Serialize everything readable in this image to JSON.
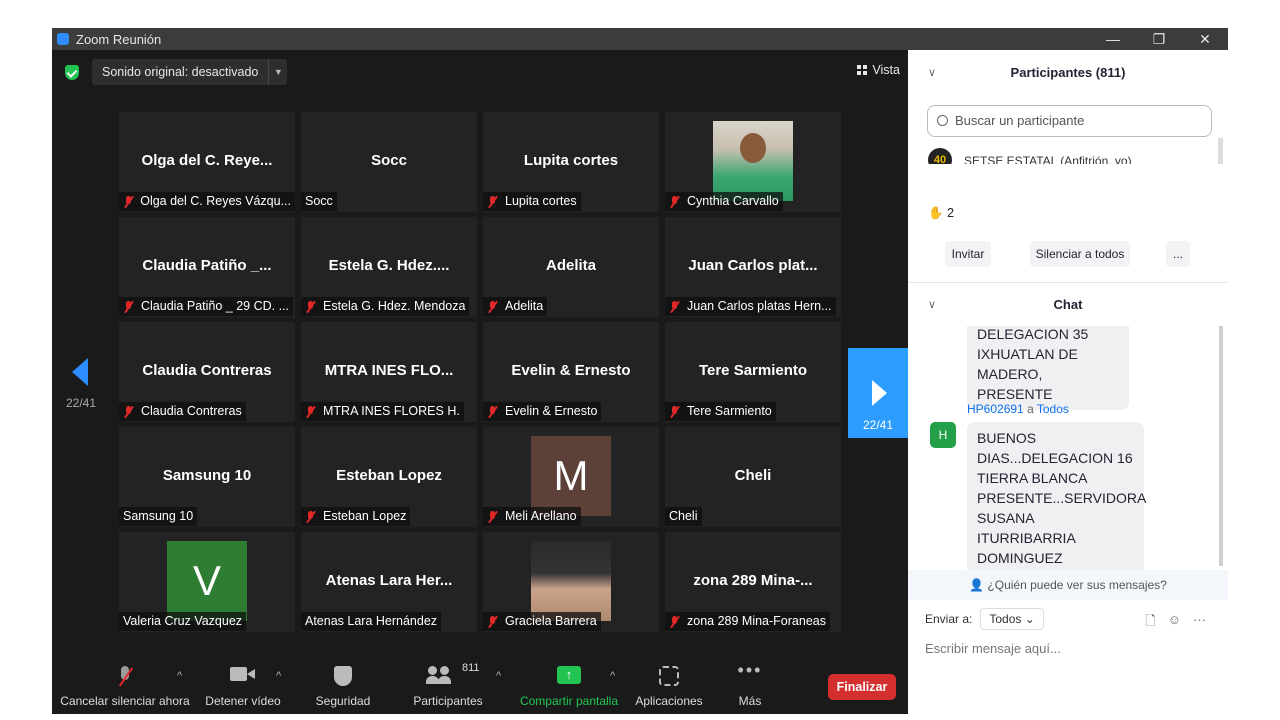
{
  "window": {
    "title": "Zoom Reunión",
    "controls": [
      "—",
      "❐",
      "✕"
    ]
  },
  "topbar": {
    "sound_label": "Sonido original: desactivado",
    "view_label": "Vista"
  },
  "gallery": {
    "page_left": "22/41",
    "page_right": "22/41",
    "tiles": [
      {
        "big": "Olga del C. Reye...",
        "name": "Olga del C. Reyes Vázqu...",
        "muted": true
      },
      {
        "big": "Socc",
        "name": "Socc",
        "muted": false
      },
      {
        "big": "Lupita cortes",
        "name": "Lupita cortes",
        "muted": true
      },
      {
        "big": "",
        "name": "Cynthia Carvallo",
        "muted": true,
        "avatar": "photo-person"
      },
      {
        "big": "Claudia Patiño _...",
        "name": "Claudia Patiño _ 29 CD. ...",
        "muted": true
      },
      {
        "big": "Estela G. Hdez....",
        "name": "Estela G. Hdez. Mendoza",
        "muted": true
      },
      {
        "big": "Adelita",
        "name": "Adelita",
        "muted": true
      },
      {
        "big": "Juan Carlos plat...",
        "name": "Juan Carlos platas Hern...",
        "muted": true
      },
      {
        "big": "Claudia Contreras",
        "name": "Claudia Contreras",
        "muted": true
      },
      {
        "big": "MTRA INES FLO...",
        "name": "MTRA INES FLORES H.",
        "muted": true
      },
      {
        "big": "Evelin & Ernesto",
        "name": "Evelin & Ernesto",
        "muted": true
      },
      {
        "big": "Tere Sarmiento",
        "name": "Tere Sarmiento",
        "muted": true
      },
      {
        "big": "Samsung 10",
        "name": "Samsung 10",
        "muted": false
      },
      {
        "big": "Esteban Lopez",
        "name": "Esteban Lopez",
        "muted": true
      },
      {
        "big": "",
        "name": "Meli Arellano",
        "muted": true,
        "avatar": "letter",
        "letter": "M",
        "color": "#5d4037"
      },
      {
        "big": "Cheli",
        "name": "Cheli",
        "muted": false
      },
      {
        "big": "",
        "name": "Valeria Cruz Vazquez",
        "muted": false,
        "avatar": "letter",
        "letter": "V",
        "color": "#2e7d32"
      },
      {
        "big": "Atenas Lara Her...",
        "name": "Atenas Lara Hernández",
        "muted": false
      },
      {
        "big": "",
        "name": "Graciela Barrera",
        "muted": true,
        "avatar": "photo-hand"
      },
      {
        "big": "zona 289 Mina-...",
        "name": "zona 289 Mina-Foraneas",
        "muted": true
      }
    ]
  },
  "toolbar": {
    "mute_label": "Cancelar silenciar ahora",
    "video_label": "Detener vídeo",
    "security_label": "Seguridad",
    "participants_label": "Participantes",
    "participants_count": "811",
    "share_label": "Compartir pantalla",
    "apps_label": "Aplicaciones",
    "more_label": "Más",
    "end_label": "Finalizar"
  },
  "participants_panel": {
    "title": "Participantes (811)",
    "search_placeholder": "Buscar un participante",
    "host_row": "SETSE ESTATAL (Anfitrión, yo)",
    "raised_hands": "2",
    "invite_label": "Invitar",
    "mute_all_label": "Silenciar a todos",
    "more_label": "..."
  },
  "chat": {
    "title": "Chat",
    "prev_message": "DELEGACION 35\nIXHUATLAN DE\nMADERO, PRESENTE",
    "sender": "HP602691",
    "to_word": "a",
    "recipient": "Todos",
    "avatar_letter": "H",
    "message": "BUENOS\nDIAS...DELEGACION 16\nTIERRA BLANCA\nPRESENTE...SERVIDORA\nSUSANA ITURRIBARRIA\nDOMINGUEZ",
    "who_can_see": "¿Quién puede ver sus mensajes?",
    "send_to_label": "Enviar a:",
    "send_to_value": "Todos",
    "input_placeholder": "Escribir mensaje aquí..."
  },
  "colors": {
    "accent": "#2d8cff",
    "end_button": "#d32f2f",
    "share_green": "#23c552",
    "muted_red": "#e02828"
  }
}
